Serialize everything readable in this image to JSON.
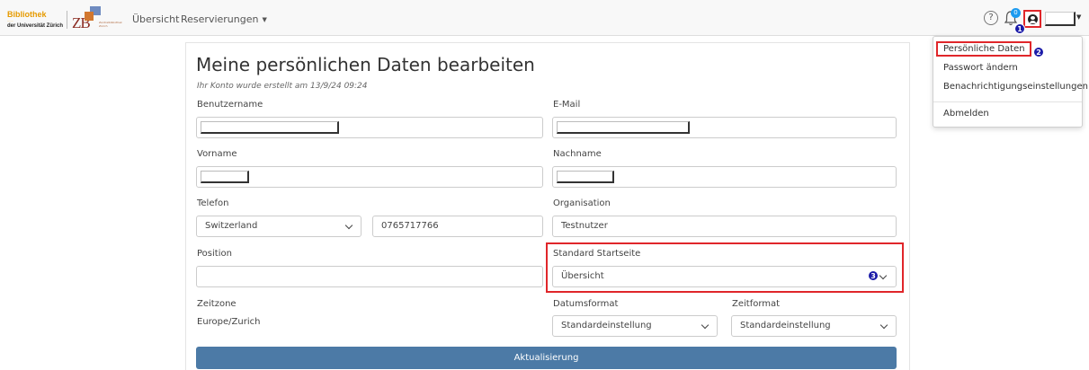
{
  "navbar": {
    "logo_line1": "Bibliothek",
    "logo_line2": "......",
    "logo_line3": "der Universität Zürich",
    "logo2_text": "ZB",
    "logo2_sub": "Zentralbibliothek Zürich",
    "nav_items": [
      "Übersicht",
      "Reservierungen"
    ],
    "notification_count": "0",
    "help_glyph": "?"
  },
  "markers": [
    "1",
    "2",
    "3"
  ],
  "user_menu": {
    "items": [
      "Persönliche Daten",
      "Passwort ändern",
      "Benachrichtigungseinstellungen",
      "Abmelden"
    ]
  },
  "form": {
    "title": "Meine persönlichen Daten bearbeiten",
    "created": "Ihr Konto wurde erstellt am 13/9/24 09:24",
    "labels": {
      "username": "Benutzername",
      "email": "E-Mail",
      "firstname": "Vorname",
      "lastname": "Nachname",
      "phone": "Telefon",
      "organisation": "Organisation",
      "position": "Position",
      "startpage": "Standard Startseite",
      "timezone": "Zeitzone",
      "dateformat": "Datumsformat",
      "timeformat": "Zeitformat"
    },
    "values": {
      "country": "Switzerland",
      "phone": "0765717766",
      "organisation": "Testnutzer",
      "position": "",
      "startpage": "Übersicht",
      "timezone": "Europe/Zurich",
      "dateformat": "Standardeinstellung",
      "timeformat": "Standardeinstellung"
    },
    "submit": "Aktualisierung"
  },
  "colors": {
    "highlight": "#e0262a",
    "marker": "#1a1aa8",
    "button": "#4c7aa6",
    "logo_orange": "#e69a00"
  }
}
